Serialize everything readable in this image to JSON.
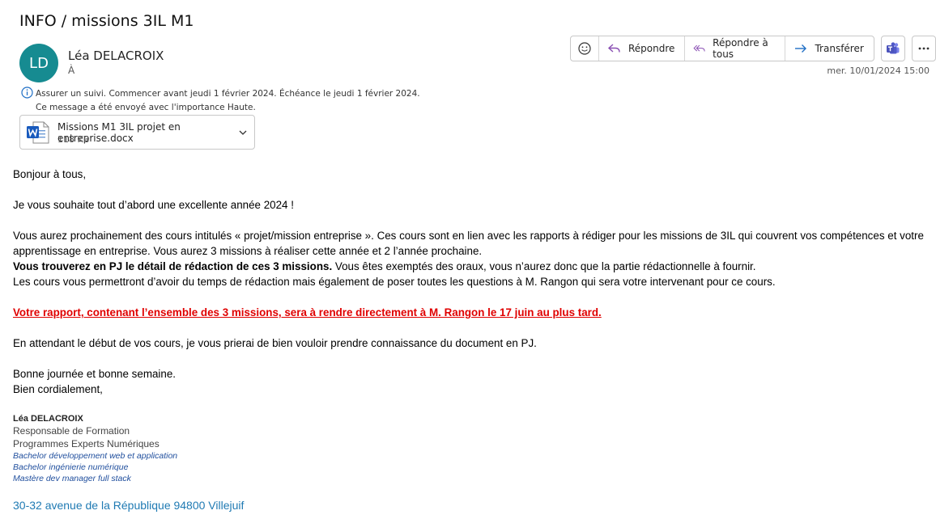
{
  "subject": "INFO / missions 3IL M1",
  "sender": {
    "initials": "LD",
    "name": "Léa DELACROIX",
    "to_label": "À",
    "avatar_color": "#168b91"
  },
  "actions": {
    "reply": "Répondre",
    "reply_all": "Répondre à tous",
    "forward": "Transférer"
  },
  "date": "mer. 10/01/2024 15:00",
  "info": {
    "line1": "Assurer un suivi.  Commencer avant jeudi 1 février 2024.  Échéance le jeudi 1 février 2024.",
    "line2": "Ce message a été envoyé avec l'importance Haute."
  },
  "attachment": {
    "name": "Missions M1 3IL projet en entreprise.docx",
    "size": "118 KB"
  },
  "body": {
    "greeting": "Bonjour à tous,",
    "wishes": "Je vous souhaite tout d’abord une excellente année 2024 !",
    "p1": "Vous aurez prochainement des cours intitulés « projet/mission entreprise ». Ces cours sont en lien avec les rapports à rédiger pour les missions de 3IL qui couvrent vos compétences et votre apprentissage en entreprise. Vous aurez 3 missions à réaliser cette année et 2 l’année prochaine.",
    "p2_bold": "Vous trouverez en PJ le détail de rédaction de ces 3 missions.",
    "p2_rest": " Vous êtes exemptés des oraux, vous n’aurez donc que la partie rédactionnelle à fournir.",
    "p3": "Les cours vous permettront d’avoir du temps de rédaction mais également de poser toutes les questions à M. Rangon qui sera votre intervenant pour ce cours.",
    "important": "Votre rapport, contenant l’ensemble des 3 missions, sera à rendre directement à M. Rangon le 17 juin au plus tard.",
    "p4": "En attendant le début de vos cours, je vous prierai de bien vouloir prendre connaissance du document en PJ.",
    "closing1": "Bonne journée et bonne semaine.",
    "closing2": "Bien cordialement,"
  },
  "signature": {
    "name": "Léa DELACROIX",
    "role1": "Responsable de Formation",
    "role2": "Programmes Experts Numériques",
    "b1": "Bachelor développement web et application",
    "b2": "Bachelor ingénierie numérique",
    "b3": "Mastère dev manager full stack",
    "address": "30-32 avenue de la République 94800 Villejuif"
  }
}
